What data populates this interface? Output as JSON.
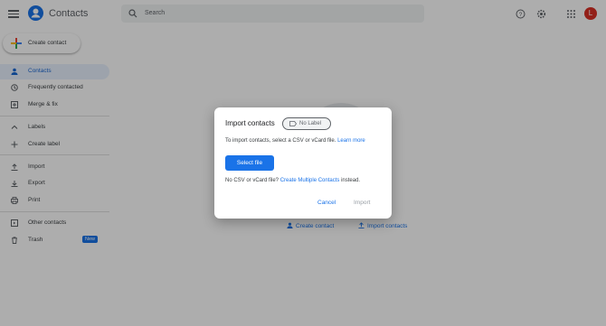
{
  "app": {
    "title": "Contacts",
    "avatar_letter": "L"
  },
  "search": {
    "placeholder": "Search"
  },
  "toolbar": {
    "icons": [
      "help-icon",
      "settings-icon",
      "apps-icon"
    ]
  },
  "create_contact": {
    "label": "Create contact"
  },
  "sidebar": {
    "items": [
      {
        "label": "Contacts",
        "icon": "person-icon",
        "active": true
      },
      {
        "label": "Frequently contacted",
        "icon": "history-icon"
      },
      {
        "label": "Merge & fix",
        "icon": "merge-icon"
      },
      {
        "label": "Labels",
        "icon": "chevron-up-icon"
      },
      {
        "label": "Create label",
        "icon": "plus-icon"
      },
      {
        "label": "Import",
        "icon": "upload-icon"
      },
      {
        "label": "Export",
        "icon": "download-icon"
      },
      {
        "label": "Print",
        "icon": "print-icon"
      },
      {
        "label": "Other contacts",
        "icon": "other-contacts-icon"
      },
      {
        "label": "Trash",
        "icon": "trash-icon",
        "badge": "New"
      }
    ]
  },
  "background": {
    "create_link": "Create contact",
    "import_link": "Import contacts"
  },
  "dialog": {
    "title": "Import contacts",
    "chip_label": "No Label",
    "description": "To import contacts, select a CSV or vCard file.",
    "learn_more": "Learn more",
    "select_file": "Select file",
    "note_prefix": "No CSV or vCard file?",
    "note_link": "Create Multiple Contacts",
    "note_suffix": "instead.",
    "cancel": "Cancel",
    "import": "Import"
  },
  "colors": {
    "accent": "#1a73e8",
    "avatar": "#d93025"
  }
}
